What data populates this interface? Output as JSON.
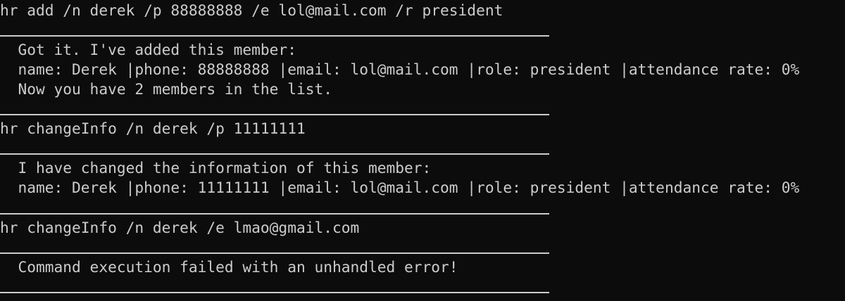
{
  "terminal": {
    "lines": [
      "hr add /n derek /p 88888888 /e lol@mail.com /r president",
      "  Got it. I've added this member:",
      "  name: Derek |phone: 88888888 |email: lol@mail.com |role: president |attendance rate: 0%",
      "  Now you have 2 members in the list.",
      "hr changeInfo /n derek /p 11111111",
      "  I have changed the information of this member:",
      "  name: Derek |phone: 11111111 |email: lol@mail.com |role: president |attendance rate: 0%",
      "hr changeInfo /n derek /e lmao@gmail.com",
      "  Command execution failed with an unhandled error!"
    ]
  }
}
